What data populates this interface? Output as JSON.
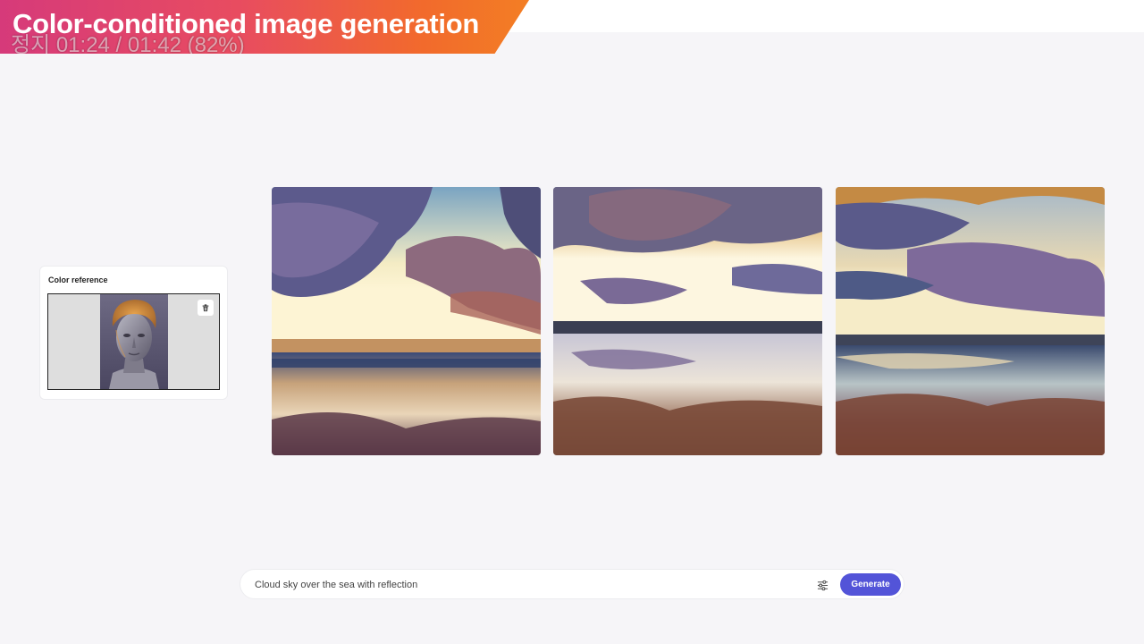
{
  "banner": {
    "title": "Color-conditioned image generation",
    "overlay": "정지 01:24 / 01:42 (82%)"
  },
  "reference": {
    "label": "Color reference",
    "delete_icon": "trash-icon"
  },
  "results": [
    {
      "name": "generated-image-1"
    },
    {
      "name": "generated-image-2"
    },
    {
      "name": "generated-image-3"
    }
  ],
  "prompt": {
    "value": "Cloud sky over the sea with reflection",
    "settings_icon": "sliders-icon",
    "generate_label": "Generate"
  },
  "colors": {
    "accent": "#5354d8",
    "banner_start": "#d63a7a",
    "banner_end": "#f37e24"
  }
}
